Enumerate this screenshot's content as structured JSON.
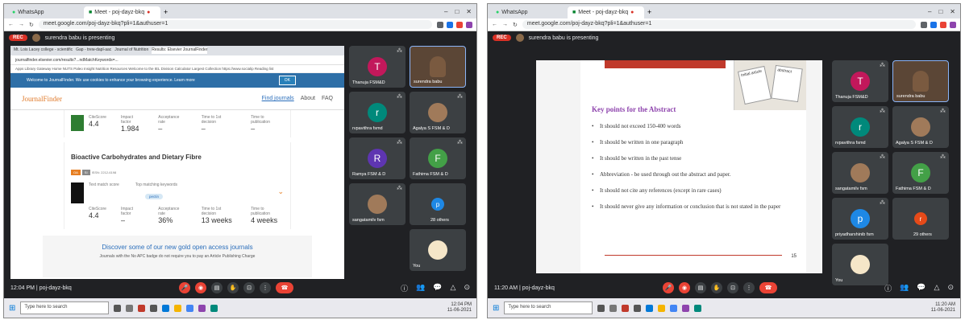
{
  "left": {
    "tabs": [
      {
        "label": "WhatsApp"
      },
      {
        "label": "Meet - poj-dayz-bkq"
      }
    ],
    "url": "meet.google.com/poj-dayz-bkq?pli=1&authuser=1",
    "rec": "REC",
    "presenting": "surendra babu is presenting",
    "inner": {
      "tabs": [
        "Mt. Lois Lacey college - scientific",
        "Gap - trew-dapl-aac",
        "Journal of Nutrition",
        "Results: Elsevier JournalFinder"
      ],
      "url": "journalfinder.elsevier.com/results?...ndMatchKeywords=...",
      "bookmarks": "Apps  Library Gateway  Home  NUTS  Paleo Insight  Nutrition Resources  Welcome to the IEL  Division Calculator  Largest Collection  https://www.socialip  Reading list",
      "cookie": "Welcome to JournalFinder. We use cookies to enhance your browsing experience. Learn more",
      "ok": "OK",
      "logo": "JournalFinder",
      "nav": [
        "Find journals",
        "About",
        "FAQ"
      ],
      "card1": {
        "labels": [
          "CiteScore",
          "Impact factor",
          "Acceptance rate",
          "Time to 1st decision",
          "Time to publication"
        ],
        "values": [
          "4.4",
          "1.984",
          "–",
          "–",
          "–"
        ]
      },
      "card2": {
        "title": "Bioactive Carbohydrates and Dietary Fibre",
        "chips": [
          "OA",
          "SI",
          "ISSN: 2212-6198"
        ],
        "labels": [
          "CiteScore",
          "Impact factor",
          "Acceptance rate",
          "Time to 1st decision",
          "Time to publication"
        ],
        "values": [
          "4.4",
          "–",
          "36%",
          "13 weeks",
          "4 weeks"
        ],
        "keywords": "Top matching keywords",
        "pectin": "pectin",
        "textmatch": "Text match score"
      },
      "gold": {
        "title": "Discover some of our new gold open access journals",
        "desc": "Journals with the No APC badge do not require you to pay an Article Publishing Charge"
      }
    },
    "tiles": [
      {
        "name": "Thanuja FSM&D",
        "initial": "T",
        "color": "#c2185b"
      },
      {
        "name": "surendra babu",
        "self": true
      },
      {
        "name": "rvpavithra fsmd",
        "initial": "r",
        "color": "#00897b"
      },
      {
        "name": "Agalya S FSM & D",
        "photo": true
      },
      {
        "name": "Ramya FSM & D",
        "initial": "R",
        "color": "#5e35b1"
      },
      {
        "name": "Fathima FSM & D",
        "initial": "F",
        "color": "#43a047"
      },
      {
        "name": "sangatamilv fsm",
        "photo": true
      },
      {
        "name": "28 others",
        "initial": "p",
        "color": "#1e88e5"
      }
    ],
    "you": "You",
    "time": "12:04 PM",
    "code": "poj-dayz-bkq",
    "search": "Type here to search",
    "clock": "12:04 PM",
    "date": "11-06-2021"
  },
  "right": {
    "tabs": [
      {
        "label": "WhatsApp"
      },
      {
        "label": "Meet - poj-dayz-bkq"
      }
    ],
    "url": "meet.google.com/poj-dayz-bkq?pli=1&authuser=1",
    "rec": "REC",
    "presenting": "surendra babu is presenting",
    "slide": {
      "title": "Key points for the Abstract",
      "paper1": "Initial article",
      "paper2": "abstract",
      "bullets": [
        "It should not exceed 150-400 words",
        "It should be written in one paragraph",
        "It should be written in the past tense",
        "Abbreviation - be used through out the abstract and paper.",
        "It should not cite any references (except in rare cases)",
        "It should never give any information or conclusion that is not stated in the paper"
      ],
      "page": "15"
    },
    "tiles": [
      {
        "name": "Thanuja FSM&D",
        "initial": "T",
        "color": "#c2185b"
      },
      {
        "name": "surendra babu",
        "self": true
      },
      {
        "name": "rvpavithra fsmd",
        "initial": "r",
        "color": "#00897b"
      },
      {
        "name": "Agalya S FSM & D",
        "photo": true
      },
      {
        "name": "sangatamilv fsm",
        "photo": true
      },
      {
        "name": "Fathima FSM & D",
        "initial": "F",
        "color": "#43a047"
      },
      {
        "name": "priyadharshinib fsm",
        "initial": "p",
        "color": "#1e88e5"
      },
      {
        "name": "29 others",
        "initial": "r",
        "color": "#e64a19"
      }
    ],
    "you": "You",
    "time": "11:20 AM",
    "code": "poj-dayz-bkq",
    "search": "Type here to search",
    "clock": "11:20 AM",
    "date": "11-06-2021"
  }
}
